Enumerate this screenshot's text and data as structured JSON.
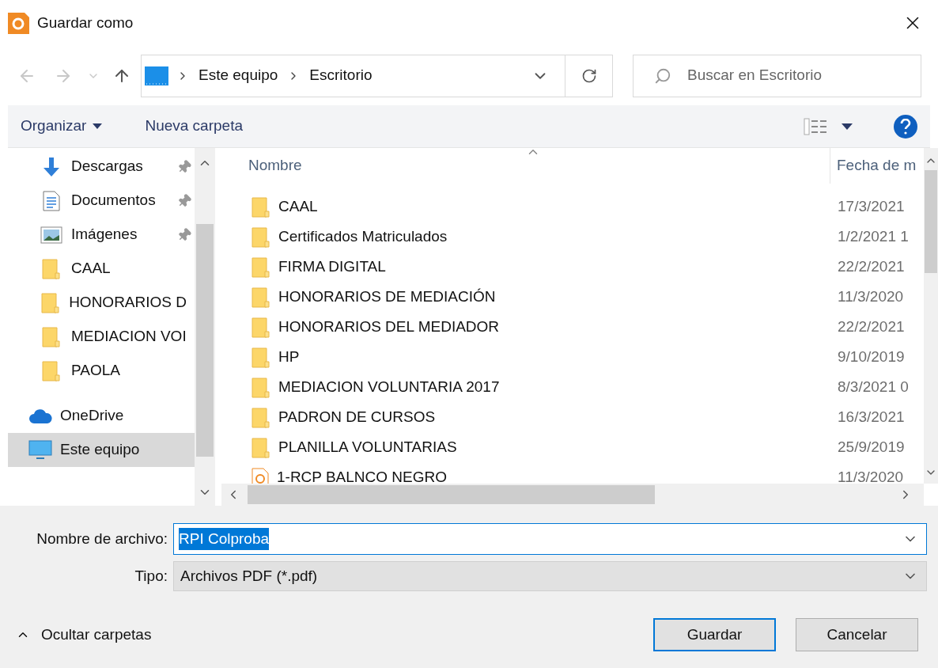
{
  "window": {
    "title": "Guardar como"
  },
  "address_bar": {
    "path": [
      "Este equipo",
      "Escritorio"
    ]
  },
  "search": {
    "placeholder": "Buscar en Escritorio"
  },
  "toolbar": {
    "organize": "Organizar",
    "new_folder": "Nueva carpeta"
  },
  "nav_pane": {
    "items": [
      {
        "kind": "downloads",
        "label": "Descargas",
        "pinned": true,
        "selected": false
      },
      {
        "kind": "documents",
        "label": "Documentos",
        "pinned": true,
        "selected": false
      },
      {
        "kind": "pictures",
        "label": "Imágenes",
        "pinned": true,
        "selected": false
      },
      {
        "kind": "folder",
        "label": "CAAL",
        "pinned": false,
        "selected": false
      },
      {
        "kind": "folder",
        "label": "HONORARIOS D",
        "pinned": false,
        "selected": false
      },
      {
        "kind": "folder",
        "label": "MEDIACION VOI",
        "pinned": false,
        "selected": false
      },
      {
        "kind": "folder",
        "label": "PAOLA",
        "pinned": false,
        "selected": false
      },
      {
        "kind": "onedrive",
        "label": "OneDrive",
        "pinned": false,
        "selected": false
      },
      {
        "kind": "computer",
        "label": "Este equipo",
        "pinned": false,
        "selected": true
      }
    ]
  },
  "file_list": {
    "columns": [
      "Nombre",
      "Fecha de m"
    ],
    "rows": [
      {
        "kind": "folder",
        "name": "CAAL",
        "date": "17/3/2021"
      },
      {
        "kind": "folder",
        "name": "Certificados Matriculados",
        "date": "1/2/2021 1"
      },
      {
        "kind": "folder",
        "name": "FIRMA DIGITAL",
        "date": "22/2/2021"
      },
      {
        "kind": "folder",
        "name": "HONORARIOS DE MEDIACIÓN",
        "date": "11/3/2020"
      },
      {
        "kind": "folder",
        "name": "HONORARIOS DEL MEDIADOR",
        "date": "22/2/2021"
      },
      {
        "kind": "folder",
        "name": "HP",
        "date": "9/10/2019"
      },
      {
        "kind": "folder",
        "name": "MEDIACION VOLUNTARIA 2017",
        "date": "8/3/2021 0"
      },
      {
        "kind": "folder",
        "name": "PADRON DE CURSOS",
        "date": "16/3/2021"
      },
      {
        "kind": "folder",
        "name": "PLANILLA VOLUNTARIAS",
        "date": "25/9/2019"
      },
      {
        "kind": "pdf",
        "name": "1-RCP BALNCO NEGRO",
        "date": "11/3/2020"
      }
    ]
  },
  "filename": {
    "label": "Nombre de archivo:",
    "value": "RPI Colproba"
  },
  "file_type": {
    "label": "Tipo:",
    "value": "Archivos PDF (*.pdf)"
  },
  "hide_folders": "Ocultar carpetas",
  "buttons": [
    {
      "label": "Guardar",
      "default": true
    },
    {
      "label": "Cancelar",
      "default": false
    }
  ]
}
